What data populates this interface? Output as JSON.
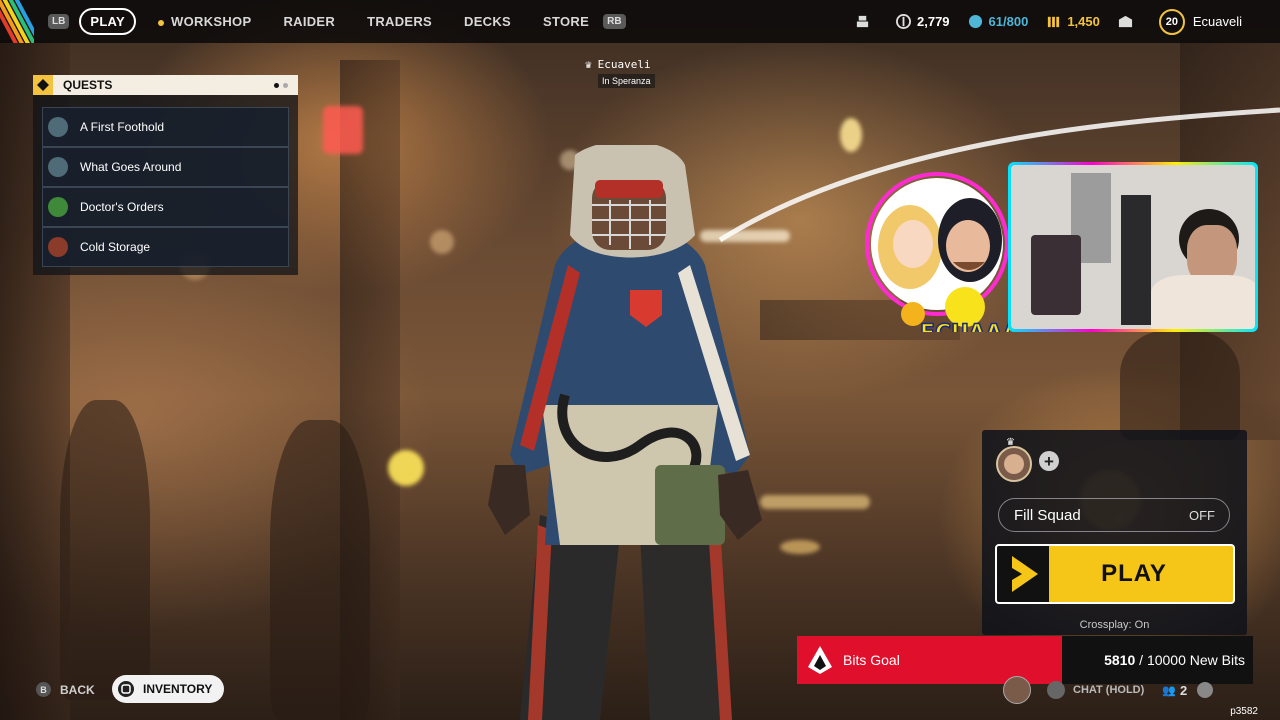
{
  "topbar": {
    "left_bumper": "LB",
    "right_bumper": "RB",
    "nav": [
      {
        "label": "PLAY",
        "active": true
      },
      {
        "label": "WORKSHOP",
        "active": false,
        "indicator": true
      },
      {
        "label": "RAIDER",
        "active": false
      },
      {
        "label": "TRADERS",
        "active": false
      },
      {
        "label": "DECKS",
        "active": false
      },
      {
        "label": "STORE",
        "active": false
      }
    ],
    "stats": {
      "coins": "2,779",
      "capacity": "61/800",
      "credits": "1,450"
    },
    "player_level": "20",
    "player_name": "Ecuaveli"
  },
  "quests": {
    "title": "QUESTS",
    "items": [
      {
        "label": "A First Foothold",
        "icon": "quest-giver-avatar",
        "color": "#4f6b78"
      },
      {
        "label": "What Goes Around",
        "icon": "quest-giver-avatar",
        "color": "#4f6b78"
      },
      {
        "label": "Doctor's Orders",
        "icon": "quest-giver-avatar",
        "color": "#3e8a3a"
      },
      {
        "label": "Cold Storage",
        "icon": "quest-giver-avatar",
        "color": "#8a3b2a"
      }
    ]
  },
  "character": {
    "name": "Ecuaveli",
    "location": "In Speranza"
  },
  "squad": {
    "fill_squad_label": "Fill Squad",
    "fill_squad_value": "OFF",
    "play_label": "PLAY",
    "crossplay": "Crossplay: On"
  },
  "overlay": {
    "logo_text": "ECUAAA",
    "bits_goal": {
      "title": "Bits Goal",
      "current": "5810",
      "goal": "10000 New Bits",
      "progress_fraction": 0.581
    }
  },
  "bottom": {
    "back_key": "B",
    "back_label": "BACK",
    "inventory_label": "INVENTORY",
    "chat_label": "CHAT (HOLD)",
    "party_count": "2"
  },
  "watermark": "p3582",
  "colors": {
    "accent": "#f5c518",
    "bits_red": "#e0102c",
    "panel_dark": "#0e121a"
  }
}
